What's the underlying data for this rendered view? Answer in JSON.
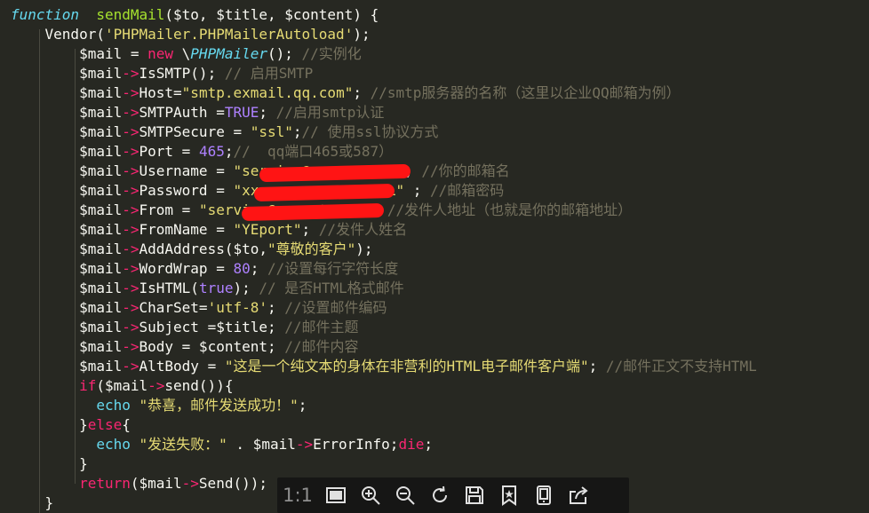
{
  "code_lines": [
    [
      [
        "tok-it",
        "function"
      ],
      [
        "",
        "  "
      ],
      [
        "tok-fn",
        "sendMail"
      ],
      [
        "",
        "($to, $title, $content) {"
      ]
    ],
    [
      [
        "",
        "    Vendor("
      ],
      [
        "tok-str",
        "'PHPMailer.PHPMailerAutoload'"
      ],
      [
        "",
        ");"
      ]
    ],
    [
      [
        "",
        "        $mail = "
      ],
      [
        "tok-kw",
        "new"
      ],
      [
        "",
        " \\"
      ],
      [
        "tok-it",
        "PHPMailer"
      ],
      [
        "",
        "(); "
      ],
      [
        "tok-cm",
        "//实例化"
      ]
    ],
    [
      [
        "",
        "        $mail"
      ],
      [
        "tok-kw",
        "->"
      ],
      [
        "",
        "IsSMTP(); "
      ],
      [
        "tok-cm",
        "// 启用SMTP"
      ]
    ],
    [
      [
        "",
        "        $mail"
      ],
      [
        "tok-kw",
        "->"
      ],
      [
        "",
        "Host="
      ],
      [
        "tok-str",
        "\"smtp.exmail.qq.com\""
      ],
      [
        "",
        "; "
      ],
      [
        "tok-cm",
        "//smtp服务器的名称（这里以企业QQ邮箱为例）"
      ]
    ],
    [
      [
        "",
        "        $mail"
      ],
      [
        "tok-kw",
        "->"
      ],
      [
        "",
        "SMTPAuth ="
      ],
      [
        "tok-num",
        "TRUE"
      ],
      [
        "",
        "; "
      ],
      [
        "tok-cm",
        "//启用smtp认证"
      ]
    ],
    [
      [
        "",
        "        $mail"
      ],
      [
        "tok-kw",
        "->"
      ],
      [
        "",
        "SMTPSecure = "
      ],
      [
        "tok-str",
        "\"ssl\""
      ],
      [
        "",
        ";"
      ],
      [
        "tok-cm",
        "// 使用ssl协议方式"
      ]
    ],
    [
      [
        "",
        "        $mail"
      ],
      [
        "tok-kw",
        "->"
      ],
      [
        "",
        "Port = "
      ],
      [
        "tok-num",
        "465"
      ],
      [
        "",
        ";"
      ],
      [
        "tok-cm",
        "//  qq端口465或587）"
      ]
    ],
    [
      [
        "",
        "        $mail"
      ],
      [
        "tok-kw",
        "->"
      ],
      [
        "",
        "Username = "
      ],
      [
        "tok-str",
        "\"service@yeport.com\""
      ],
      [
        "",
        "; "
      ],
      [
        "tok-cm",
        "//你的邮箱名"
      ]
    ],
    [
      [
        "",
        "        $mail"
      ],
      [
        "tok-kw",
        "->"
      ],
      [
        "",
        "Password = "
      ],
      [
        "tok-str",
        "\"xxxxxxxxxxxxxxxxCL\""
      ],
      [
        "",
        " ; "
      ],
      [
        "tok-cm",
        "//邮箱密码"
      ]
    ],
    [
      [
        "",
        "        $mail"
      ],
      [
        "tok-kw",
        "->"
      ],
      [
        "",
        "From = "
      ],
      [
        "tok-str",
        "\"service@yeport.com\""
      ],
      [
        "",
        "; "
      ],
      [
        "tok-cm",
        "//发件人地址（也就是你的邮箱地址）"
      ]
    ],
    [
      [
        "",
        "        $mail"
      ],
      [
        "tok-kw",
        "->"
      ],
      [
        "",
        "FromName = "
      ],
      [
        "tok-str",
        "\"YEport\""
      ],
      [
        "",
        "; "
      ],
      [
        "tok-cm",
        "//发件人姓名"
      ]
    ],
    [
      [
        "",
        "        $mail"
      ],
      [
        "tok-kw",
        "->"
      ],
      [
        "",
        "AddAddress($to,"
      ],
      [
        "tok-str",
        "\"尊敬的客户\""
      ],
      [
        "",
        ");"
      ]
    ],
    [
      [
        "",
        "        $mail"
      ],
      [
        "tok-kw",
        "->"
      ],
      [
        "",
        "WordWrap = "
      ],
      [
        "tok-num",
        "80"
      ],
      [
        "",
        "; "
      ],
      [
        "tok-cm",
        "//设置每行字符长度"
      ]
    ],
    [
      [
        "",
        "        $mail"
      ],
      [
        "tok-kw",
        "->"
      ],
      [
        "",
        "IsHTML("
      ],
      [
        "tok-num",
        "true"
      ],
      [
        "",
        "); "
      ],
      [
        "tok-cm",
        "// 是否HTML格式邮件"
      ]
    ],
    [
      [
        "",
        "        $mail"
      ],
      [
        "tok-kw",
        "->"
      ],
      [
        "",
        "CharSet="
      ],
      [
        "tok-str",
        "'utf-8'"
      ],
      [
        "",
        "; "
      ],
      [
        "tok-cm",
        "//设置邮件编码"
      ]
    ],
    [
      [
        "",
        "        $mail"
      ],
      [
        "tok-kw",
        "->"
      ],
      [
        "",
        "Subject =$title; "
      ],
      [
        "tok-cm",
        "//邮件主题"
      ]
    ],
    [
      [
        "",
        "        $mail"
      ],
      [
        "tok-kw",
        "->"
      ],
      [
        "",
        "Body = $content; "
      ],
      [
        "tok-cm",
        "//邮件内容"
      ]
    ],
    [
      [
        "",
        "        $mail"
      ],
      [
        "tok-kw",
        "->"
      ],
      [
        "",
        "AltBody = "
      ],
      [
        "tok-str",
        "\"这是一个纯文本的身体在非营利的HTML电子邮件客户端\""
      ],
      [
        "",
        "; "
      ],
      [
        "tok-cm",
        "//邮件正文不支持HTML"
      ]
    ],
    [
      [
        "tok-kw",
        "        if"
      ],
      [
        "",
        "($mail"
      ],
      [
        "tok-kw",
        "->"
      ],
      [
        "",
        "send()){"
      ]
    ],
    [
      [
        "",
        "          "
      ],
      [
        "tok-sp",
        "echo"
      ],
      [
        "",
        " "
      ],
      [
        "tok-str",
        "\"恭喜，邮件发送成功！\""
      ],
      [
        "",
        ";"
      ]
    ],
    [
      [
        "",
        "        }"
      ],
      [
        "tok-kw",
        "else"
      ],
      [
        "",
        "{"
      ]
    ],
    [
      [
        "",
        "          "
      ],
      [
        "tok-sp",
        "echo"
      ],
      [
        "",
        " "
      ],
      [
        "tok-str",
        "\"发送失败：\""
      ],
      [
        "",
        " . $mail"
      ],
      [
        "tok-kw",
        "->"
      ],
      [
        "",
        "ErrorInfo;"
      ],
      [
        "tok-kw",
        "die"
      ],
      [
        "",
        ";"
      ]
    ],
    [
      [
        "",
        "        }"
      ]
    ],
    [
      [
        "tok-kw",
        "        return"
      ],
      [
        "",
        "($mail"
      ],
      [
        "tok-kw",
        "->"
      ],
      [
        "",
        "Send());"
      ]
    ],
    [
      [
        "",
        "    }"
      ]
    ]
  ],
  "toolbar": {
    "ratio_label": "1:1",
    "icons": [
      "fit-screen-icon",
      "zoom-in-icon",
      "zoom-out-icon",
      "rotate-icon",
      "save-icon",
      "bookmark-icon",
      "phone-icon",
      "share-icon"
    ]
  },
  "colors": {
    "background": "#272822",
    "keyword": "#F92672",
    "function": "#A6E22E",
    "string": "#E6DB74",
    "number": "#AE81FF",
    "comment": "#75715E",
    "type": "#66D9EF",
    "redaction": "#FF1414"
  }
}
